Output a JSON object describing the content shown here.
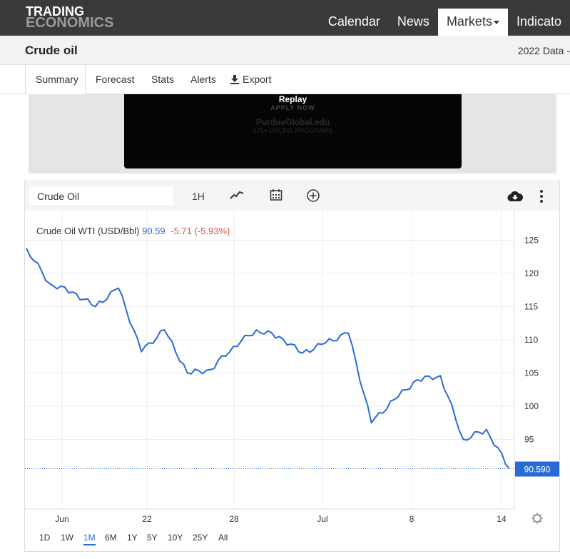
{
  "header": {
    "logo_line1": "TRADING",
    "logo_line2": "ECONOMICS",
    "nav": [
      {
        "label": "Calendar"
      },
      {
        "label": "News"
      },
      {
        "label": "Markets"
      },
      {
        "label": "Indicato"
      }
    ]
  },
  "titlebar": {
    "title": "Crude oil",
    "right_text": "2022 Data -"
  },
  "tabs": {
    "summary": "Summary",
    "forecast": "Forecast",
    "stats": "Stats",
    "alerts": "Alerts",
    "export": "Export"
  },
  "ad": {
    "line1": "Replay",
    "line2": "APPLY NOW",
    "line3": "PurdueGlobal.edu",
    "line4": "175+ ONLINE PROGRAMS"
  },
  "chart_toolbar": {
    "symbol": "Crude Oil",
    "interval": "1H",
    "icons": [
      "line-chart-icon",
      "calendar-icon",
      "add-circle-icon",
      "cloud-download-icon",
      "more-vert-icon",
      "settings-icon"
    ]
  },
  "chart_info": {
    "name": "Crude Oil WTI (USD/Bbl)",
    "price": "90.59",
    "change": "-5.71 (-5.93%)"
  },
  "colors": {
    "line": "#2a6ad8",
    "change_negative": "#d9534f",
    "last_price_bg": "#2a6ad8"
  },
  "ranges": [
    "1D",
    "1W",
    "1M",
    "6M",
    "1Y",
    "5Y",
    "10Y",
    "25Y",
    "All"
  ],
  "active_range": "1M",
  "chart_data": {
    "type": "line",
    "title": "Crude Oil WTI (USD/Bbl)",
    "xlabel": "",
    "ylabel": "",
    "ylim": [
      85,
      127
    ],
    "y_ticks": [
      95,
      100,
      105,
      110,
      115,
      120,
      125
    ],
    "x_tick_labels": [
      "Jun",
      "22",
      "28",
      "Jul",
      "8",
      "14"
    ],
    "last_value_label": "90.590",
    "last_value": 90.59,
    "grid": true,
    "series": [
      {
        "name": "Crude Oil WTI (USD/Bbl)",
        "x_dates": [
          "Jun 15",
          "Jun 16",
          "Jun 17",
          "Jun 20",
          "Jun 21",
          "Jun 22",
          "Jun 23",
          "Jun 24",
          "Jun 27",
          "Jun 28",
          "Jun 29",
          "Jun 30",
          "Jul 1",
          "Jul 5",
          "Jul 6",
          "Jul 7",
          "Jul 8",
          "Jul 11",
          "Jul 12",
          "Jul 13",
          "Jul 14",
          "Jul 15"
        ],
        "values": [
          123.8,
          118.5,
          117.2,
          115.0,
          117.8,
          108.2,
          111.5,
          105.0,
          105.5,
          109.0,
          111.5,
          110.5,
          108.0,
          109.5,
          111.0,
          97.5,
          101.0,
          104.0,
          104.6,
          95.0,
          96.5,
          90.59
        ]
      }
    ]
  }
}
